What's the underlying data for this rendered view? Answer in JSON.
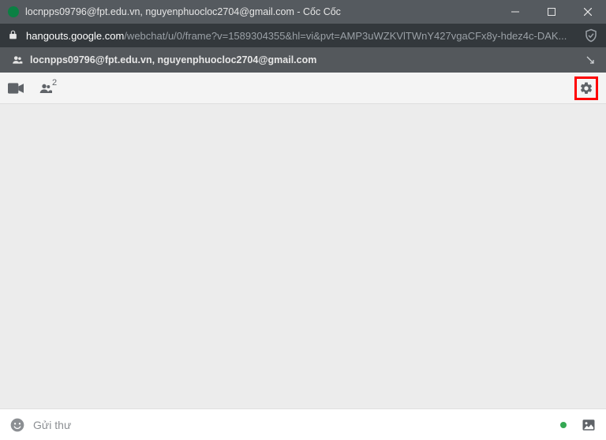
{
  "window": {
    "title": "locnpps09796@fpt.edu.vn, nguyenphuocloc2704@gmail.com - Cốc Cốc"
  },
  "address": {
    "host": "hangouts.google.com",
    "path": "/webchat/u/0/frame?v=1589304355&hl=vi&pvt=AMP3uWZKVlTWnY427vgaCFx8y-hdez4c-DAK..."
  },
  "subheader": {
    "participants": "locnpps09796@fpt.edu.vn, nguyenphuocloc2704@gmail.com"
  },
  "toolbar": {
    "people_count": "2"
  },
  "compose": {
    "placeholder": "Gửi thư"
  },
  "colors": {
    "annotation": "#ff0000",
    "favicon": "#0b8043",
    "presence": "#34a853"
  }
}
